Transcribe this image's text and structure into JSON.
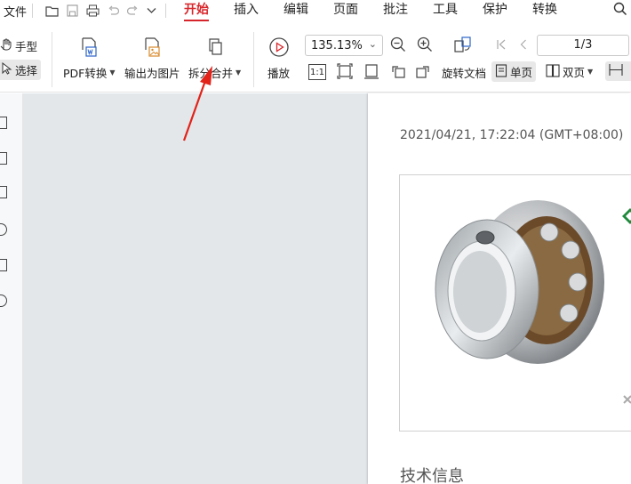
{
  "menubar": {
    "file_label": "文件",
    "tabs": [
      {
        "label": "开始",
        "active": true
      },
      {
        "label": "插入",
        "active": false
      },
      {
        "label": "编辑",
        "active": false
      },
      {
        "label": "页面",
        "active": false
      },
      {
        "label": "批注",
        "active": false
      },
      {
        "label": "工具",
        "active": false
      },
      {
        "label": "保护",
        "active": false
      },
      {
        "label": "转换",
        "active": false
      }
    ],
    "accent_color": "#d7262b"
  },
  "ribbon": {
    "hand_tool": "手型",
    "select_tool": "选择",
    "pdf_convert": "PDF转换",
    "export_image": "输出为图片",
    "split_merge": "拆分合并",
    "play": "播放",
    "zoom_value": "135.13%",
    "rotate_doc": "旋转文档",
    "page_current": "1/3",
    "single_page": "单页",
    "double_page": "双页",
    "fit_label": "1:1"
  },
  "document": {
    "timestamp": "2021/04/21, 17:22:04 (GMT+08:00)",
    "section_title": "技术信息"
  }
}
